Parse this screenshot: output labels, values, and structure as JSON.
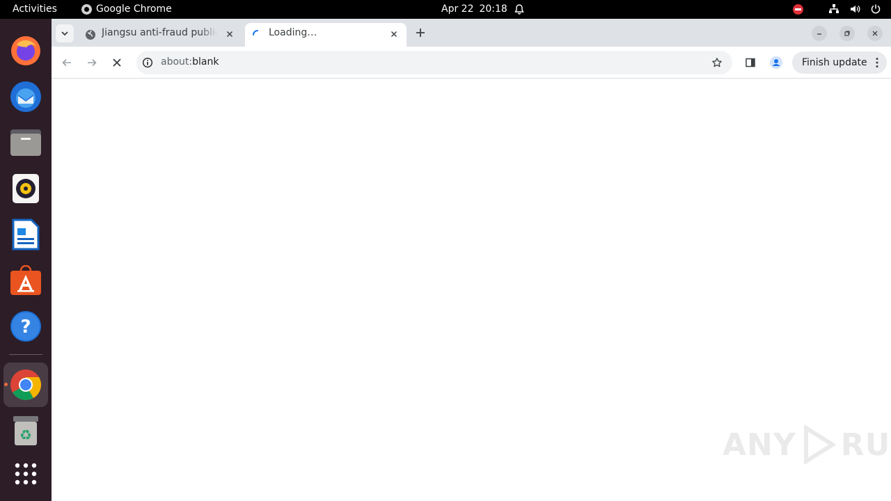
{
  "topbar": {
    "activities_label": "Activities",
    "app_name": "Google Chrome",
    "date": "Apr 22",
    "time": "20:18"
  },
  "dock": {
    "items": [
      "firefox-icon",
      "thunderbird-icon",
      "files-icon",
      "rhythmbox-icon",
      "libreoffice-writer-icon",
      "app-center-icon",
      "help-icon",
      "chrome-icon",
      "trash-icon",
      "show-apps-icon"
    ]
  },
  "browser": {
    "tabs": [
      {
        "title": "Jiangsu anti-fraud public",
        "favicon": "globe-icon",
        "active": false
      },
      {
        "title": "Loading…",
        "favicon": "spinner-icon",
        "active": true
      }
    ],
    "address": {
      "scheme": "about:",
      "rest": "blank"
    },
    "finish_update_label": "Finish update"
  },
  "watermark": {
    "text_left": "ANY",
    "text_right": "RUN"
  },
  "colors": {
    "accent": "#1a73e8",
    "ubuntu_orange": "#e95420",
    "dock_bg": "#2c1d27"
  }
}
